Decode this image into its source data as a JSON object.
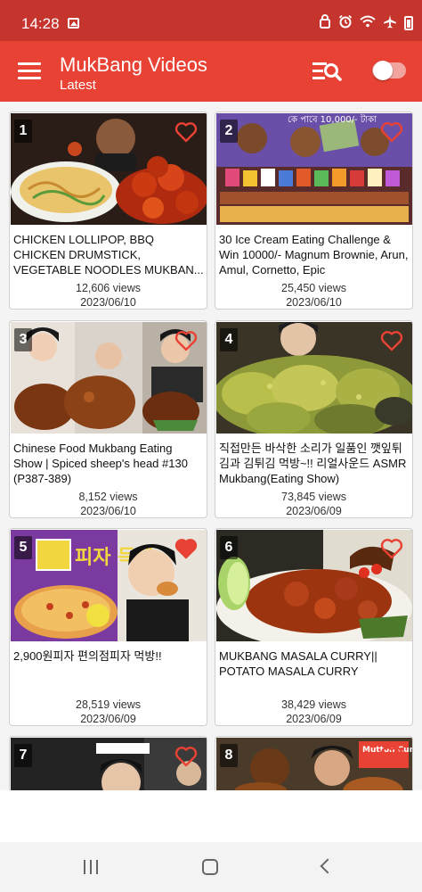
{
  "status_bar": {
    "time": "14:28",
    "icons": [
      "gallery-icon",
      "lock-icon",
      "alarm-icon",
      "wifi-icon",
      "airplane-icon",
      "battery-icon"
    ]
  },
  "app_bar": {
    "title": "MukBang Videos",
    "subtitle": "Latest",
    "icons": [
      "menu-icon",
      "filter-search-icon",
      "toggle-switch"
    ],
    "colors": {
      "bar": "#e84234",
      "status": "#c5342d"
    }
  },
  "videos": [
    {
      "number": "1",
      "title": "CHICKEN LOLLIPOP,  BBQ CHICKEN DRUMSTICK, VEGETABLE NOODLES MUKBAN...",
      "views": "12,606 views",
      "date": "2023/06/10"
    },
    {
      "number": "2",
      "title": "30 Ice Cream Eating Challenge & Win 10000/- Magnum Brownie, Arun, Amul, Cornetto, Epic",
      "views": "25,450 views",
      "date": "2023/06/10",
      "thumb_text": "কে পাবে 10,000/- টাকা"
    },
    {
      "number": "3",
      "title": "Chinese Food Mukbang Eating Show | Spiced sheep's head #130 (P387-389)",
      "views": "8,152 views",
      "date": "2023/06/10"
    },
    {
      "number": "4",
      "title": "직접만든 바삭한 소리가 일품인 깻잎튀김과 김튀김 먹방~!! 리얼사운드 ASMR Mukbang(Eating Show)",
      "views": "73,845 views",
      "date": "2023/06/09"
    },
    {
      "number": "5",
      "title": "2,900원피자 편의점피자 먹방!!",
      "views": "28,519 views",
      "date": "2023/06/09",
      "thumb_text": "피자 득템"
    },
    {
      "number": "6",
      "title": "MUKBANG MASALA CURRY|| POTATO MASALA CURRY",
      "views": "38,429 views",
      "date": "2023/06/09"
    },
    {
      "number": "7",
      "title": "",
      "views": "",
      "date": ""
    },
    {
      "number": "8",
      "title": "",
      "views": "",
      "date": "",
      "thumb_text": "Mutton Curry"
    }
  ],
  "nav_bar": {
    "icons": [
      "recents-icon",
      "home-icon",
      "back-icon"
    ]
  }
}
